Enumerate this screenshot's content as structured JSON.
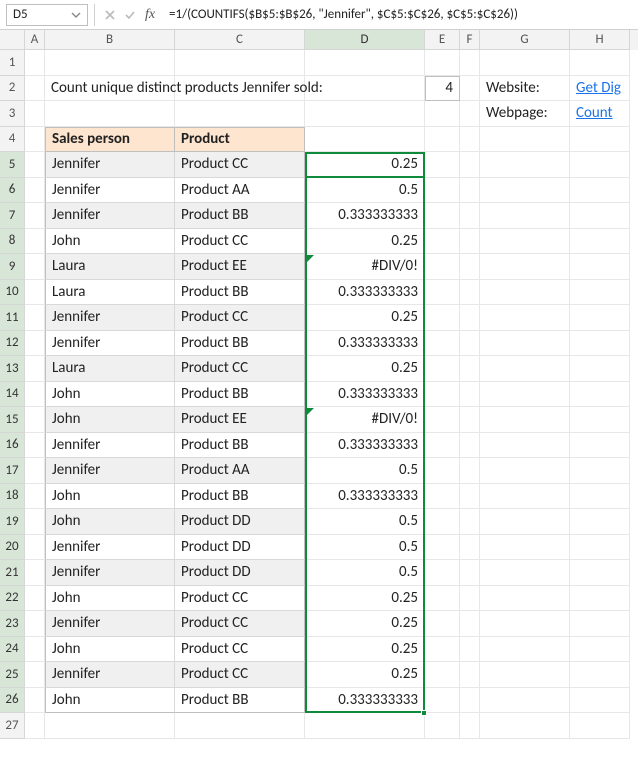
{
  "namebox": "D5",
  "formula": "=1/(COUNTIFS($B$5:$B$26, \"Jennifer\", $C$5:$C$26, $C$5:$C$26))",
  "cols": [
    "A",
    "B",
    "C",
    "D",
    "E",
    "F",
    "G",
    "H"
  ],
  "title_text": "Count unique distinct products  Jennifer sold:",
  "title_value": "4",
  "headers": {
    "b": "Sales person",
    "c": "Product"
  },
  "links": {
    "website_label": "Website:",
    "website_link": "Get Dig",
    "webpage_label": "Webpage:",
    "webpage_link": "Count "
  },
  "rows": [
    {
      "n": 5,
      "p": "Jennifer",
      "pr": "Product CC",
      "v": "0.25",
      "z": true,
      "err": false
    },
    {
      "n": 6,
      "p": "Jennifer",
      "pr": "Product AA",
      "v": "0.5",
      "z": false,
      "err": false
    },
    {
      "n": 7,
      "p": "Jennifer",
      "pr": "Product BB",
      "v": "0.333333333",
      "z": true,
      "err": false
    },
    {
      "n": 8,
      "p": "John",
      "pr": "Product CC",
      "v": "0.25",
      "z": false,
      "err": false
    },
    {
      "n": 9,
      "p": "Laura",
      "pr": "Product EE",
      "v": "#DIV/0!",
      "z": true,
      "err": true
    },
    {
      "n": 10,
      "p": "Laura",
      "pr": "Product BB",
      "v": "0.333333333",
      "z": false,
      "err": false
    },
    {
      "n": 11,
      "p": "Jennifer",
      "pr": "Product CC",
      "v": "0.25",
      "z": true,
      "err": false
    },
    {
      "n": 12,
      "p": "Jennifer",
      "pr": "Product BB",
      "v": "0.333333333",
      "z": false,
      "err": false
    },
    {
      "n": 13,
      "p": "Laura",
      "pr": "Product CC",
      "v": "0.25",
      "z": true,
      "err": false
    },
    {
      "n": 14,
      "p": "John",
      "pr": "Product BB",
      "v": "0.333333333",
      "z": false,
      "err": false
    },
    {
      "n": 15,
      "p": "John",
      "pr": "Product EE",
      "v": "#DIV/0!",
      "z": true,
      "err": true
    },
    {
      "n": 16,
      "p": "Jennifer",
      "pr": "Product BB",
      "v": "0.333333333",
      "z": false,
      "err": false
    },
    {
      "n": 17,
      "p": "Jennifer",
      "pr": "Product AA",
      "v": "0.5",
      "z": true,
      "err": false
    },
    {
      "n": 18,
      "p": "John",
      "pr": "Product BB",
      "v": "0.333333333",
      "z": false,
      "err": false
    },
    {
      "n": 19,
      "p": "John",
      "pr": "Product DD",
      "v": "0.5",
      "z": true,
      "err": false
    },
    {
      "n": 20,
      "p": "Jennifer",
      "pr": "Product DD",
      "v": "0.5",
      "z": false,
      "err": false
    },
    {
      "n": 21,
      "p": "Jennifer",
      "pr": "Product DD",
      "v": "0.5",
      "z": true,
      "err": false
    },
    {
      "n": 22,
      "p": "John",
      "pr": "Product CC",
      "v": "0.25",
      "z": false,
      "err": false
    },
    {
      "n": 23,
      "p": "Jennifer",
      "pr": "Product CC",
      "v": "0.25",
      "z": true,
      "err": false
    },
    {
      "n": 24,
      "p": "John",
      "pr": "Product CC",
      "v": "0.25",
      "z": false,
      "err": false
    },
    {
      "n": 25,
      "p": "Jennifer",
      "pr": "Product CC",
      "v": "0.25",
      "z": true,
      "err": false
    },
    {
      "n": 26,
      "p": "John",
      "pr": "Product BB",
      "v": "0.333333333",
      "z": false,
      "err": false
    }
  ]
}
